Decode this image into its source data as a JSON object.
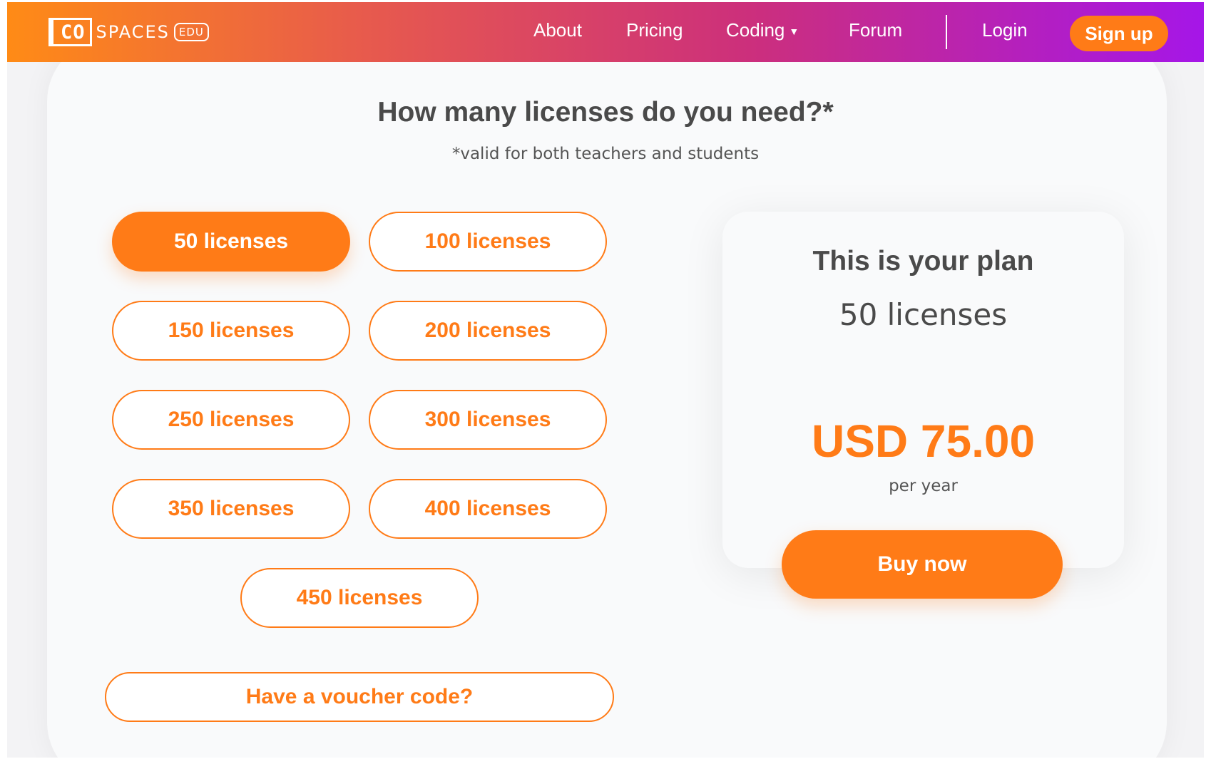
{
  "nav": {
    "logo": {
      "co": "CO",
      "spaces": "SPACES",
      "edu": "EDU"
    },
    "items": [
      {
        "label": "About"
      },
      {
        "label": "Pricing"
      },
      {
        "label": "Coding"
      },
      {
        "label": "Forum"
      },
      {
        "label": "Login"
      }
    ],
    "signup_label": "Sign up"
  },
  "main": {
    "heading": "How many licenses do you need?*",
    "subheading": "*valid for both teachers and students",
    "licenses": [
      {
        "label": "50 licenses",
        "selected": true
      },
      {
        "label": "100 licenses",
        "selected": false
      },
      {
        "label": "150 licenses",
        "selected": false
      },
      {
        "label": "200 licenses",
        "selected": false
      },
      {
        "label": "250 licenses",
        "selected": false
      },
      {
        "label": "300 licenses",
        "selected": false
      },
      {
        "label": "350 licenses",
        "selected": false
      },
      {
        "label": "400 licenses",
        "selected": false
      },
      {
        "label": "450 licenses",
        "selected": false
      }
    ],
    "voucher_label": "Have a voucher code?"
  },
  "plan": {
    "title": "This is your plan",
    "count": "50 licenses",
    "price": "USD 75.00",
    "period": "per year",
    "buy_label": "Buy now"
  },
  "colors": {
    "accent": "#ff7b17",
    "nav_gradient_start": "#ff8b16",
    "nav_gradient_end": "#a516e8",
    "text_dark": "#4a4a4a"
  }
}
